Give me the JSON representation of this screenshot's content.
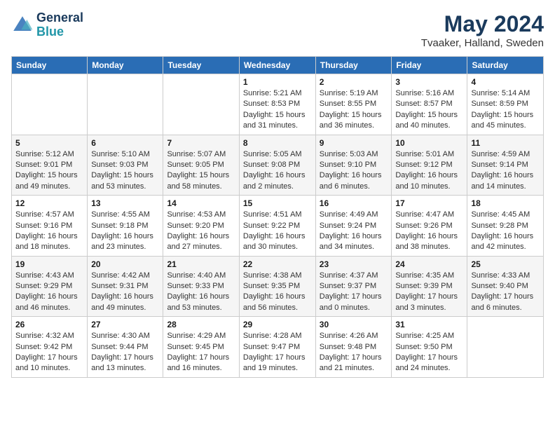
{
  "header": {
    "logo_line1": "General",
    "logo_line2": "Blue",
    "month": "May 2024",
    "location": "Tvaaker, Halland, Sweden"
  },
  "days_of_week": [
    "Sunday",
    "Monday",
    "Tuesday",
    "Wednesday",
    "Thursday",
    "Friday",
    "Saturday"
  ],
  "weeks": [
    [
      {
        "day": "",
        "info": ""
      },
      {
        "day": "",
        "info": ""
      },
      {
        "day": "",
        "info": ""
      },
      {
        "day": "1",
        "info": "Sunrise: 5:21 AM\nSunset: 8:53 PM\nDaylight: 15 hours\nand 31 minutes."
      },
      {
        "day": "2",
        "info": "Sunrise: 5:19 AM\nSunset: 8:55 PM\nDaylight: 15 hours\nand 36 minutes."
      },
      {
        "day": "3",
        "info": "Sunrise: 5:16 AM\nSunset: 8:57 PM\nDaylight: 15 hours\nand 40 minutes."
      },
      {
        "day": "4",
        "info": "Sunrise: 5:14 AM\nSunset: 8:59 PM\nDaylight: 15 hours\nand 45 minutes."
      }
    ],
    [
      {
        "day": "5",
        "info": "Sunrise: 5:12 AM\nSunset: 9:01 PM\nDaylight: 15 hours\nand 49 minutes."
      },
      {
        "day": "6",
        "info": "Sunrise: 5:10 AM\nSunset: 9:03 PM\nDaylight: 15 hours\nand 53 minutes."
      },
      {
        "day": "7",
        "info": "Sunrise: 5:07 AM\nSunset: 9:05 PM\nDaylight: 15 hours\nand 58 minutes."
      },
      {
        "day": "8",
        "info": "Sunrise: 5:05 AM\nSunset: 9:08 PM\nDaylight: 16 hours\nand 2 minutes."
      },
      {
        "day": "9",
        "info": "Sunrise: 5:03 AM\nSunset: 9:10 PM\nDaylight: 16 hours\nand 6 minutes."
      },
      {
        "day": "10",
        "info": "Sunrise: 5:01 AM\nSunset: 9:12 PM\nDaylight: 16 hours\nand 10 minutes."
      },
      {
        "day": "11",
        "info": "Sunrise: 4:59 AM\nSunset: 9:14 PM\nDaylight: 16 hours\nand 14 minutes."
      }
    ],
    [
      {
        "day": "12",
        "info": "Sunrise: 4:57 AM\nSunset: 9:16 PM\nDaylight: 16 hours\nand 18 minutes."
      },
      {
        "day": "13",
        "info": "Sunrise: 4:55 AM\nSunset: 9:18 PM\nDaylight: 16 hours\nand 23 minutes."
      },
      {
        "day": "14",
        "info": "Sunrise: 4:53 AM\nSunset: 9:20 PM\nDaylight: 16 hours\nand 27 minutes."
      },
      {
        "day": "15",
        "info": "Sunrise: 4:51 AM\nSunset: 9:22 PM\nDaylight: 16 hours\nand 30 minutes."
      },
      {
        "day": "16",
        "info": "Sunrise: 4:49 AM\nSunset: 9:24 PM\nDaylight: 16 hours\nand 34 minutes."
      },
      {
        "day": "17",
        "info": "Sunrise: 4:47 AM\nSunset: 9:26 PM\nDaylight: 16 hours\nand 38 minutes."
      },
      {
        "day": "18",
        "info": "Sunrise: 4:45 AM\nSunset: 9:28 PM\nDaylight: 16 hours\nand 42 minutes."
      }
    ],
    [
      {
        "day": "19",
        "info": "Sunrise: 4:43 AM\nSunset: 9:29 PM\nDaylight: 16 hours\nand 46 minutes."
      },
      {
        "day": "20",
        "info": "Sunrise: 4:42 AM\nSunset: 9:31 PM\nDaylight: 16 hours\nand 49 minutes."
      },
      {
        "day": "21",
        "info": "Sunrise: 4:40 AM\nSunset: 9:33 PM\nDaylight: 16 hours\nand 53 minutes."
      },
      {
        "day": "22",
        "info": "Sunrise: 4:38 AM\nSunset: 9:35 PM\nDaylight: 16 hours\nand 56 minutes."
      },
      {
        "day": "23",
        "info": "Sunrise: 4:37 AM\nSunset: 9:37 PM\nDaylight: 17 hours\nand 0 minutes."
      },
      {
        "day": "24",
        "info": "Sunrise: 4:35 AM\nSunset: 9:39 PM\nDaylight: 17 hours\nand 3 minutes."
      },
      {
        "day": "25",
        "info": "Sunrise: 4:33 AM\nSunset: 9:40 PM\nDaylight: 17 hours\nand 6 minutes."
      }
    ],
    [
      {
        "day": "26",
        "info": "Sunrise: 4:32 AM\nSunset: 9:42 PM\nDaylight: 17 hours\nand 10 minutes."
      },
      {
        "day": "27",
        "info": "Sunrise: 4:30 AM\nSunset: 9:44 PM\nDaylight: 17 hours\nand 13 minutes."
      },
      {
        "day": "28",
        "info": "Sunrise: 4:29 AM\nSunset: 9:45 PM\nDaylight: 17 hours\nand 16 minutes."
      },
      {
        "day": "29",
        "info": "Sunrise: 4:28 AM\nSunset: 9:47 PM\nDaylight: 17 hours\nand 19 minutes."
      },
      {
        "day": "30",
        "info": "Sunrise: 4:26 AM\nSunset: 9:48 PM\nDaylight: 17 hours\nand 21 minutes."
      },
      {
        "day": "31",
        "info": "Sunrise: 4:25 AM\nSunset: 9:50 PM\nDaylight: 17 hours\nand 24 minutes."
      },
      {
        "day": "",
        "info": ""
      }
    ]
  ]
}
